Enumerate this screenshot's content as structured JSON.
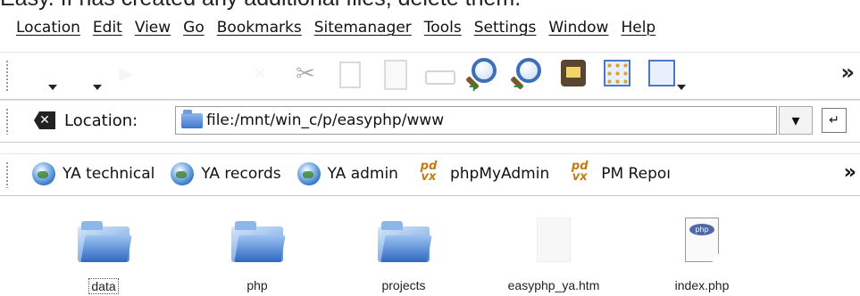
{
  "caption": "Easy. If  has created any additional files, delete them.",
  "menu": [
    "Location",
    "Edit",
    "View",
    "Go",
    "Bookmarks",
    "Sitemanager",
    "Tools",
    "Settings",
    "Window",
    "Help"
  ],
  "nav_toolbar": {
    "icons": [
      "home-icon",
      "back-icon",
      "forward-icon",
      "up-icon",
      "reload-icon",
      "stop-icon",
      "cut-icon",
      "copy-icon",
      "paste-icon",
      "print-icon",
      "zoom-in-icon",
      "zoom-out-icon",
      "security-icon",
      "view-mode-icon",
      "tree-view-icon"
    ],
    "overflow": "»"
  },
  "location_bar": {
    "label": "Location:",
    "value": "file:/mnt/win_c/p/easyphp/www"
  },
  "bookmarks": [
    {
      "label": "YA technical",
      "icon": "globe-icon"
    },
    {
      "label": "YA records",
      "icon": "globe-icon"
    },
    {
      "label": "YA admin",
      "icon": "globe-icon"
    },
    {
      "label": "phpMyAdmin",
      "icon": "phpmyadmin-icon"
    },
    {
      "label": "PM Repoı",
      "icon": "phpmyadmin-icon"
    }
  ],
  "bookmarks_overflow": "»",
  "files": [
    {
      "name": "data",
      "type": "folder",
      "selected": true
    },
    {
      "name": "php",
      "type": "folder"
    },
    {
      "name": "projects",
      "type": "folder"
    },
    {
      "name": "easyphp_ya.htm",
      "type": "html"
    },
    {
      "name": "index.php",
      "type": "php"
    }
  ],
  "colors": {
    "accent": "#2a5fbf",
    "folder": "#5f93d9"
  }
}
